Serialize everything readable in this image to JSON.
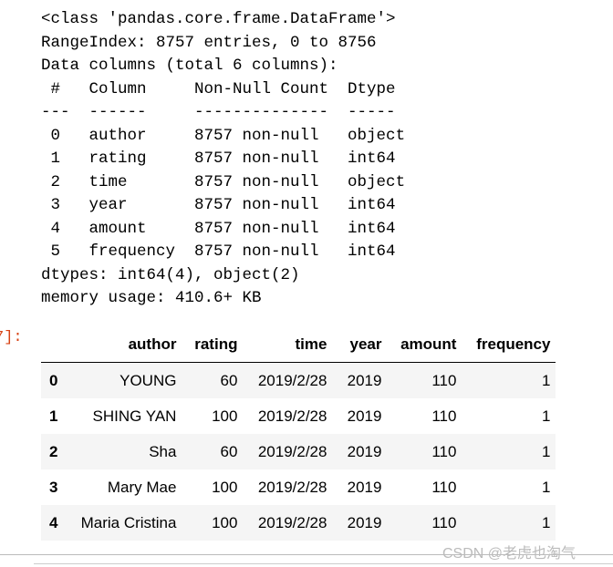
{
  "output_lines": [
    "<class 'pandas.core.frame.DataFrame'>",
    "RangeIndex: 8757 entries, 0 to 8756",
    "Data columns (total 6 columns):",
    " #   Column     Non-Null Count  Dtype ",
    "---  ------     --------------  ----- ",
    " 0   author     8757 non-null   object",
    " 1   rating     8757 non-null   int64 ",
    " 2   time       8757 non-null   object",
    " 3   year       8757 non-null   int64 ",
    " 4   amount     8757 non-null   int64 ",
    " 5   frequency  8757 non-null   int64 ",
    "dtypes: int64(4), object(2)",
    "memory usage: 410.6+ KB"
  ],
  "prompt": "7]:",
  "table": {
    "columns": [
      "author",
      "rating",
      "time",
      "year",
      "amount",
      "frequency"
    ],
    "rows": [
      {
        "index": "0",
        "cells": [
          "YOUNG",
          "60",
          "2019/2/28",
          "2019",
          "110",
          "1"
        ]
      },
      {
        "index": "1",
        "cells": [
          "SHING YAN",
          "100",
          "2019/2/28",
          "2019",
          "110",
          "1"
        ]
      },
      {
        "index": "2",
        "cells": [
          "Sha",
          "60",
          "2019/2/28",
          "2019",
          "110",
          "1"
        ]
      },
      {
        "index": "3",
        "cells": [
          "Mary Mae",
          "100",
          "2019/2/28",
          "2019",
          "110",
          "1"
        ]
      },
      {
        "index": "4",
        "cells": [
          "Maria Cristina",
          "100",
          "2019/2/28",
          "2019",
          "110",
          "1"
        ]
      }
    ]
  },
  "watermark": "CSDN @老虎也淘气"
}
